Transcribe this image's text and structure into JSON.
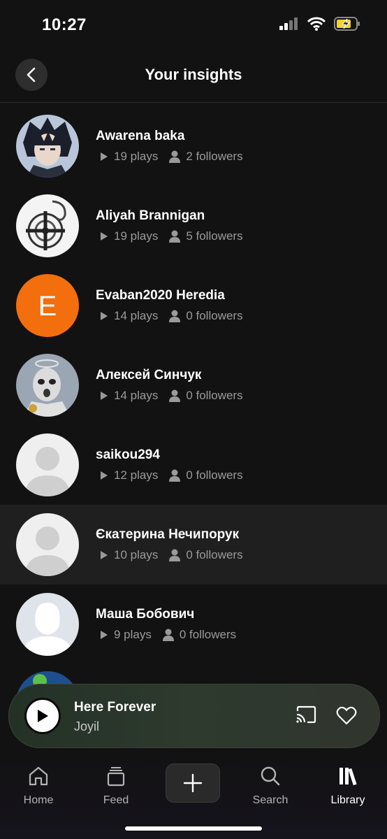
{
  "status_bar": {
    "time": "10:27"
  },
  "header": {
    "title": "Your insights"
  },
  "listeners": [
    {
      "name": "Awarena baka",
      "plays": "19 plays",
      "followers": "2 followers"
    },
    {
      "name": "Aliyah Brannigan",
      "plays": "19 plays",
      "followers": "5 followers"
    },
    {
      "name": "Evaban2020 Heredia",
      "plays": "14 plays",
      "followers": "0 followers",
      "initial": "E"
    },
    {
      "name": "Алексей Синчук",
      "plays": "14 plays",
      "followers": "0 followers"
    },
    {
      "name": "saikou294",
      "plays": "12 plays",
      "followers": "0 followers"
    },
    {
      "name": "Єкатерина Нечипорук",
      "plays": "10 plays",
      "followers": "0 followers"
    },
    {
      "name": "Маша Бобович",
      "plays": "9 plays",
      "followers": "0 followers"
    }
  ],
  "mini_player": {
    "title": "Here Forever",
    "artist": "Joyil"
  },
  "nav": {
    "home": "Home",
    "feed": "Feed",
    "search": "Search",
    "library": "Library"
  },
  "colors": {
    "background": "#121212",
    "secondary_text": "#9a9a9a",
    "orange_avatar": "#f36e0c"
  },
  "icons": [
    "back-arrow-icon",
    "play-icon",
    "person-icon",
    "cast-icon",
    "heart-icon",
    "home-icon",
    "feed-icon",
    "plus-icon",
    "search-icon",
    "library-icon"
  ]
}
